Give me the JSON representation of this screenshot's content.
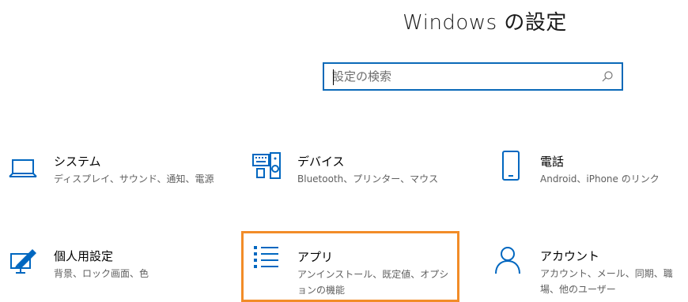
{
  "header": {
    "title": "Windows の設定"
  },
  "search": {
    "placeholder": "設定の検索"
  },
  "tiles": [
    {
      "name": "システム",
      "desc": "ディスプレイ、サウンド、通知、電源",
      "icon": "laptop-icon"
    },
    {
      "name": "デバイス",
      "desc": "Bluetooth、プリンター、マウス",
      "icon": "devices-icon"
    },
    {
      "name": "電話",
      "desc": "Android、iPhone のリンク",
      "icon": "phone-icon"
    },
    {
      "name": "個人用設定",
      "desc": "背景、ロック画面、色",
      "icon": "personalization-icon"
    },
    {
      "name": "アプリ",
      "desc": "アンインストール、既定値、オプションの機能",
      "icon": "apps-list-icon"
    },
    {
      "name": "アカウント",
      "desc": "アカウント、メール、同期、職場、他のユーザー",
      "icon": "account-icon"
    }
  ],
  "colors": {
    "accent": "#0067c0",
    "search_border": "#0a69b8",
    "selected_outline": "#f28c28"
  }
}
